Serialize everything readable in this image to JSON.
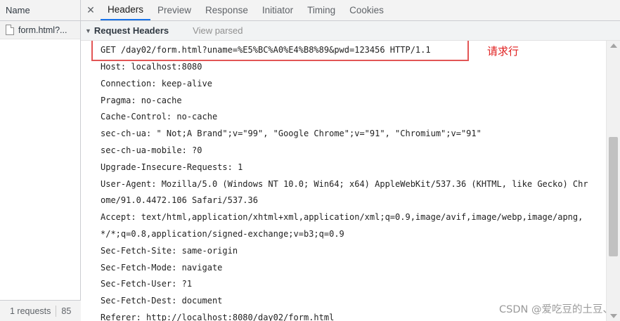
{
  "left": {
    "header": "Name",
    "requests": [
      {
        "name": "form.html?..."
      }
    ],
    "footer": {
      "requests": "1 requests",
      "transferred": "85"
    }
  },
  "tabs": [
    "Headers",
    "Preview",
    "Response",
    "Initiator",
    "Timing",
    "Cookies"
  ],
  "active_tab": "Headers",
  "section": {
    "title": "Request Headers",
    "toggle": "View parsed"
  },
  "request_line": "GET /day02/form.html?uname=%E5%BC%A0%E4%B8%89&pwd=123456 HTTP/1.1",
  "annotation": "请求行",
  "header_lines": [
    "Host: localhost:8080",
    "Connection: keep-alive",
    "Pragma: no-cache",
    "Cache-Control: no-cache",
    "sec-ch-ua: \" Not;A Brand\";v=\"99\", \"Google Chrome\";v=\"91\", \"Chromium\";v=\"91\"",
    "sec-ch-ua-mobile: ?0",
    "Upgrade-Insecure-Requests: 1",
    "User-Agent: Mozilla/5.0 (Windows NT 10.0; Win64; x64) AppleWebKit/537.36 (KHTML, like Gecko) Chr",
    "ome/91.0.4472.106 Safari/537.36",
    "Accept: text/html,application/xhtml+xml,application/xml;q=0.9,image/avif,image/webp,image/apng,",
    "*/*;q=0.8,application/signed-exchange;v=b3;q=0.9",
    "Sec-Fetch-Site: same-origin",
    "Sec-Fetch-Mode: navigate",
    "Sec-Fetch-User: ?1",
    "Sec-Fetch-Dest: document",
    "Referer: http://localhost:8080/day02/form.html"
  ],
  "watermark": "CSDN @爱吃豆的土豆、",
  "colors": {
    "accent": "#1a73e8",
    "highlight": "#e25555",
    "annotation": "#e02020"
  }
}
